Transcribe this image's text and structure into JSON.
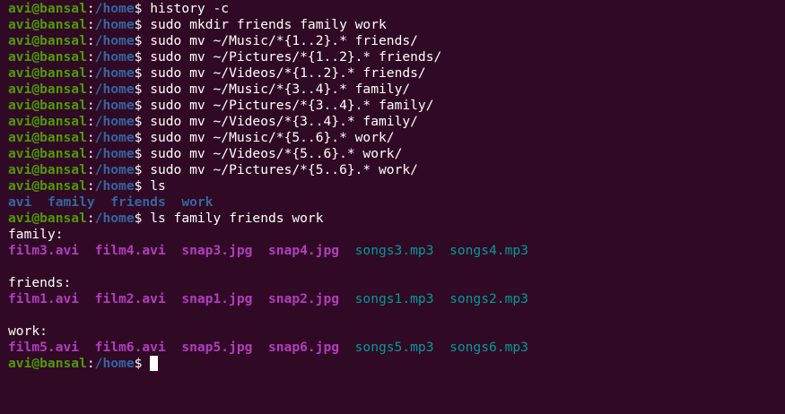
{
  "prompt": {
    "user_host": "avi@bansal",
    "colon": ":",
    "path": "/home",
    "dollar": "$"
  },
  "commands": [
    "history -c",
    "sudo mkdir friends family work",
    "sudo mv ~/Music/*{1..2}.* friends/",
    "sudo mv ~/Pictures/*{1..2}.* friends/",
    "sudo mv ~/Videos/*{1..2}.* friends/",
    "sudo mv ~/Music/*{3..4}.* family/",
    "sudo mv ~/Pictures/*{3..4}.* family/",
    "sudo mv ~/Videos/*{3..4}.* family/",
    "sudo mv ~/Music/*{5..6}.* work/",
    "sudo mv ~/Videos/*{5..6}.* work/",
    "sudo mv ~/Pictures/*{5..6}.* work/",
    "ls",
    "ls family friends work"
  ],
  "ls_output": [
    "avi",
    "family",
    "friends",
    "work"
  ],
  "groups": [
    {
      "header": "family:",
      "files": [
        "film3.avi",
        "film4.avi",
        "snap3.jpg",
        "snap4.jpg",
        "songs3.mp3",
        "songs4.mp3"
      ]
    },
    {
      "header": "friends:",
      "files": [
        "film1.avi",
        "film2.avi",
        "snap1.jpg",
        "snap2.jpg",
        "songs1.mp3",
        "songs2.mp3"
      ]
    },
    {
      "header": "work:",
      "files": [
        "film5.avi",
        "film6.avi",
        "snap5.jpg",
        "snap6.jpg",
        "songs5.mp3",
        "songs6.mp3"
      ]
    }
  ],
  "colors": {
    "background": "#300a24",
    "user": "#4e9a06",
    "path": "#3465a4",
    "media": "#b23cc0",
    "audio": "#06989a",
    "text": "#ffffff"
  }
}
